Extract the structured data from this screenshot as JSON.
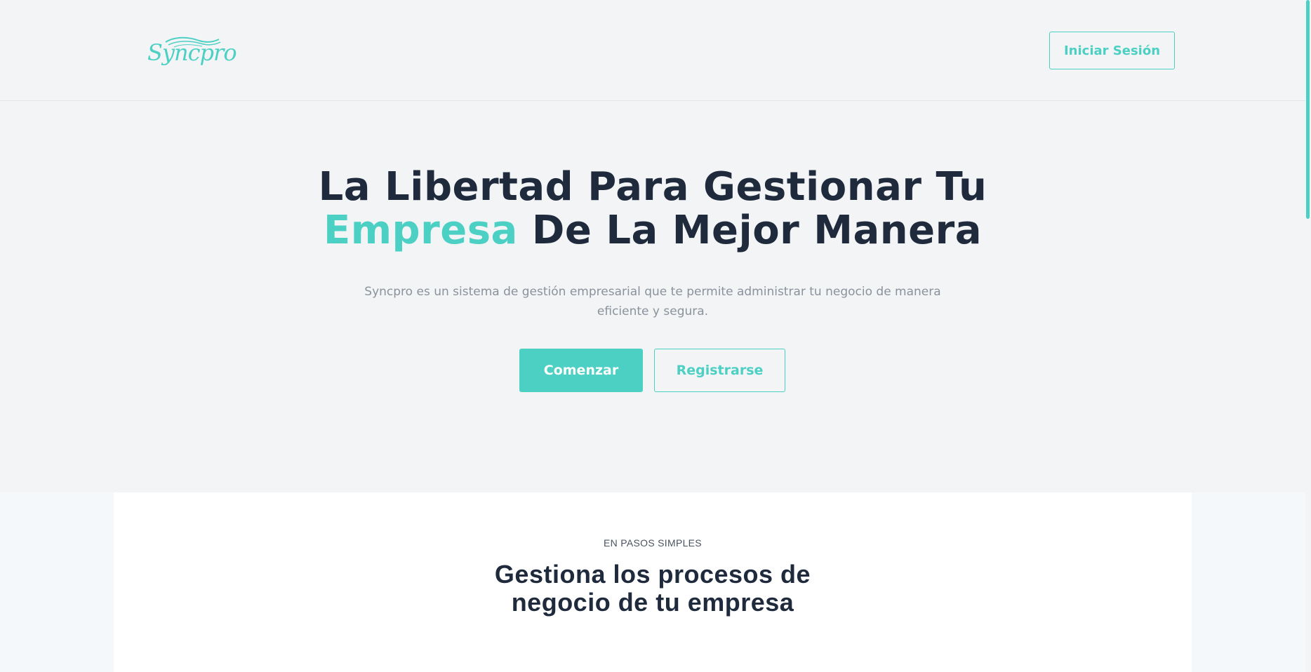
{
  "header": {
    "logo_text": "Syncpro",
    "login_label": "Iniciar Sesión"
  },
  "hero": {
    "title_line1": "La Libertad Para Gestionar Tu",
    "title_accent": "Empresa",
    "title_line2_rest": " De La Mejor Manera",
    "subtitle": "Syncpro es un sistema de gestión empresarial que te permite administrar tu negocio de manera eficiente y segura.",
    "primary_button": "Comenzar",
    "secondary_button": "Registrarse"
  },
  "steps_section": {
    "kicker": "EN PASOS SIMPLES",
    "title_line1": "Gestiona los procesos de",
    "title_line2": "negocio de tu empresa"
  },
  "colors": {
    "accent": "#4dd0c4",
    "heading": "#1f2a3c",
    "muted_text": "#8a929c",
    "background": "#f2f4f6"
  }
}
